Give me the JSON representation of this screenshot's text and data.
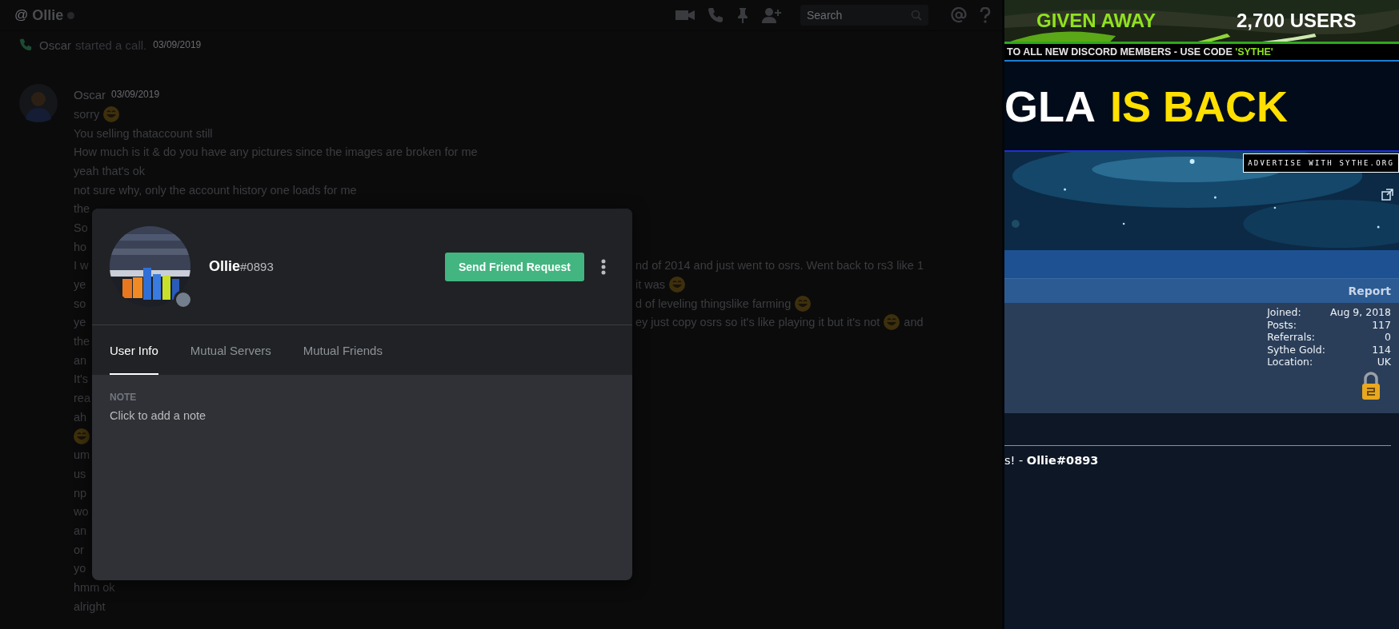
{
  "header": {
    "at": "@",
    "title": "Ollie",
    "search": {
      "placeholder": "Search"
    }
  },
  "call": {
    "name": "Oscar",
    "text": "started a call.",
    "time": "03/09/2019"
  },
  "message": {
    "author": "Oscar",
    "time": "03/09/2019",
    "lines": [
      {
        "left": [
          {
            "kind": "text",
            "text": "sorry"
          },
          {
            "kind": "emoji"
          }
        ]
      },
      {
        "left": [
          {
            "kind": "text",
            "text": "You selling thataccount still"
          }
        ]
      },
      {
        "left": [
          {
            "kind": "text",
            "text": "How much is it & do you have any pictures since the images are broken for me"
          }
        ]
      },
      {
        "left": [
          {
            "kind": "text",
            "text": "yeah that's ok"
          }
        ]
      },
      {
        "left": [
          {
            "kind": "text",
            "text": "not sure why, only the account history one loads for me"
          }
        ]
      },
      {
        "left": [
          {
            "kind": "text",
            "text": "the"
          }
        ]
      },
      {
        "left": [
          {
            "kind": "text",
            "text": "So"
          }
        ]
      },
      {
        "left": [
          {
            "kind": "text",
            "text": "ho"
          }
        ]
      },
      {
        "left": [
          {
            "kind": "text",
            "text": "I w"
          }
        ],
        "tail": [
          {
            "kind": "text",
            "text": "nd of 2014 and just went to osrs. Went back to rs3 like 1"
          }
        ]
      },
      {
        "left": [
          {
            "kind": "text",
            "text": "ye"
          }
        ],
        "tail": [
          {
            "kind": "text",
            "text": "it was"
          },
          {
            "kind": "emoji"
          }
        ]
      },
      {
        "left": [
          {
            "kind": "text",
            "text": "so"
          }
        ],
        "tail": [
          {
            "kind": "text",
            "text": "d of leveling thingslike farming"
          },
          {
            "kind": "emoji"
          }
        ]
      },
      {
        "left": [
          {
            "kind": "text",
            "text": "ye"
          }
        ],
        "tail": [
          {
            "kind": "text",
            "text": "ey just copy osrs so it's like playing it but it's not"
          },
          {
            "kind": "emoji"
          },
          {
            "kind": "text",
            "text": "and"
          }
        ]
      },
      {
        "left": [
          {
            "kind": "text",
            "text": "the"
          }
        ]
      },
      {
        "left": [
          {
            "kind": "text",
            "text": "an"
          }
        ]
      },
      {
        "left": [
          {
            "kind": "text",
            "text": "It's"
          }
        ]
      },
      {
        "left": [
          {
            "kind": "text",
            "text": "rea"
          }
        ]
      },
      {
        "left": [
          {
            "kind": "text",
            "text": "ah"
          }
        ]
      },
      {
        "left": [
          {
            "kind": "emoji"
          }
        ]
      },
      {
        "left": [
          {
            "kind": "text",
            "text": "um"
          }
        ]
      },
      {
        "left": [
          {
            "kind": "text",
            "text": "us"
          }
        ]
      },
      {
        "left": [
          {
            "kind": "text",
            "text": "np"
          }
        ]
      },
      {
        "left": [
          {
            "kind": "text",
            "text": "wo"
          }
        ]
      },
      {
        "left": [
          {
            "kind": "text",
            "text": "an"
          }
        ]
      },
      {
        "left": [
          {
            "kind": "text",
            "text": "or"
          }
        ]
      },
      {
        "left": [
          {
            "kind": "text",
            "text": "yo"
          }
        ]
      },
      {
        "left": [
          {
            "kind": "text",
            "text": "hmm ok"
          }
        ]
      },
      {
        "left": [
          {
            "kind": "text",
            "text": "alright"
          }
        ]
      }
    ]
  },
  "profile": {
    "name": "Ollie",
    "tag": "#0893",
    "online": false,
    "button": "Send Friend Request",
    "tabs": [
      {
        "label": "User Info",
        "selected": true
      },
      {
        "label": "Mutual Servers",
        "selected": false
      },
      {
        "label": "Mutual Friends",
        "selected": false
      }
    ],
    "note_label": "NOTE",
    "note_placeholder": "Click to add a note"
  },
  "forum": {
    "ad_top": {
      "left": "GIVEN AWAY",
      "right": "2,700 USERS"
    },
    "ad_strip": {
      "text": "TO ALL NEW DISCORD MEMBERS - USE CODE ",
      "code": "'SYTHE'"
    },
    "ad_banner": {
      "white": "GLA",
      "yellow": "IS BACK"
    },
    "advertise": "ADVERTISE WITH SYTHE.ORG",
    "report": "Report",
    "stats": [
      {
        "label": "Joined:",
        "value": "Aug 9, 2018"
      },
      {
        "label": "Posts:",
        "value": "117"
      },
      {
        "label": "Referrals:",
        "value": "0"
      },
      {
        "label": "Sythe Gold:",
        "value": "114"
      },
      {
        "label": "Location:",
        "value": "UK"
      }
    ],
    "signature": "s! - **Ollie#0893**"
  }
}
